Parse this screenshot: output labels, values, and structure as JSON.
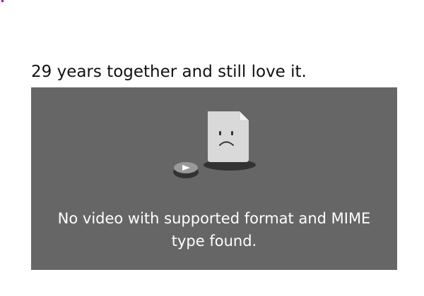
{
  "post": {
    "caption": "29 years together and still love it."
  },
  "video": {
    "error_message": "No video with supported format and MIME type found.",
    "icons": {
      "document": "sad-document-icon",
      "play": "play-button-icon"
    },
    "colors": {
      "background": "#666666",
      "document": "#d9d9d9",
      "shadow": "#333333"
    }
  }
}
